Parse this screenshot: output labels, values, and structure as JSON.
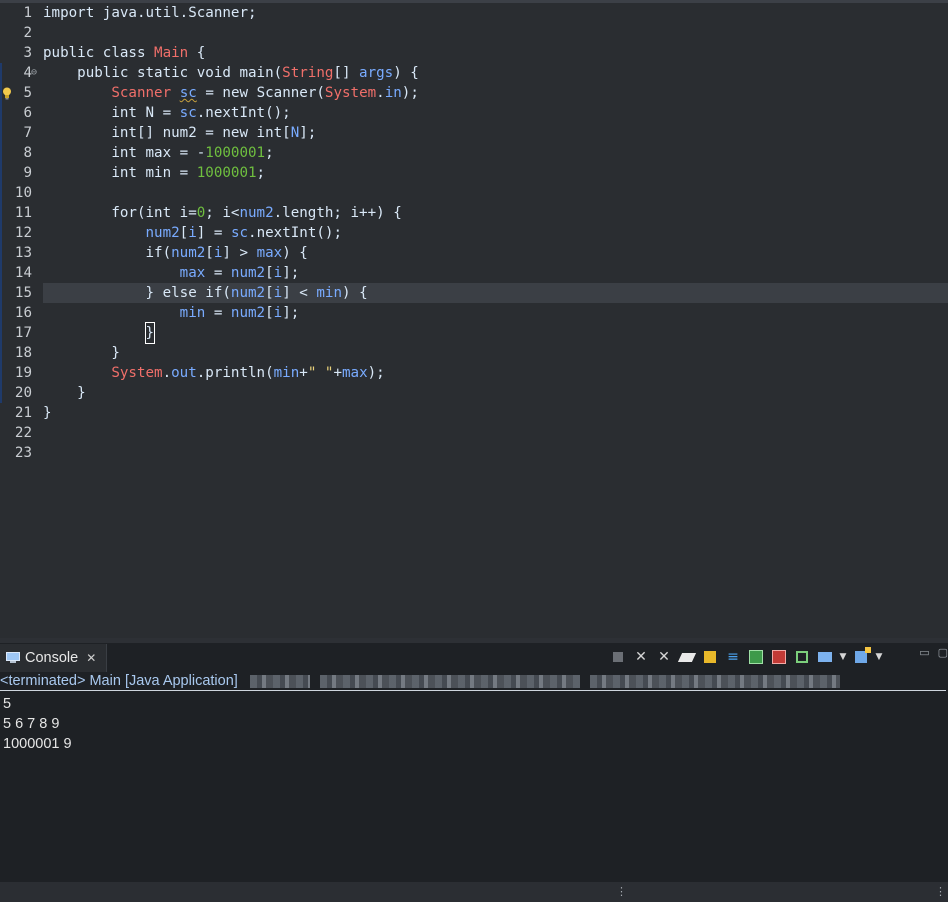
{
  "editor": {
    "lines": [
      {
        "n": "1",
        "tokens": [
          [
            "kw",
            "import java.util.Scanner;"
          ]
        ]
      },
      {
        "n": "2",
        "tokens": []
      },
      {
        "n": "3",
        "tokens": [
          [
            "kw",
            "public class "
          ],
          [
            "type",
            "Main"
          ],
          [
            "kw",
            " {"
          ]
        ]
      },
      {
        "n": "4",
        "tokens": [
          [
            "kw",
            "    public static void main("
          ],
          [
            "type",
            "String"
          ],
          [
            "kw",
            "[] "
          ],
          [
            "var",
            "args"
          ],
          [
            "kw",
            ") {"
          ]
        ]
      },
      {
        "n": "5",
        "tokens": [
          [
            "kw",
            "        "
          ],
          [
            "type",
            "Scanner"
          ],
          [
            "kw",
            " "
          ],
          [
            "var squig",
            "sc"
          ],
          [
            "kw",
            " = new Scanner("
          ],
          [
            "type",
            "System"
          ],
          [
            "kw",
            "."
          ],
          [
            "fld",
            "in"
          ],
          [
            "kw",
            ");"
          ]
        ]
      },
      {
        "n": "6",
        "tokens": [
          [
            "kw",
            "        int N = "
          ],
          [
            "var",
            "sc"
          ],
          [
            "kw",
            ".nextInt();"
          ]
        ]
      },
      {
        "n": "7",
        "tokens": [
          [
            "kw",
            "        int[] num2 = new int["
          ],
          [
            "var",
            "N"
          ],
          [
            "kw",
            "];"
          ]
        ]
      },
      {
        "n": "8",
        "tokens": [
          [
            "kw",
            "        int max = -"
          ],
          [
            "num",
            "1000001"
          ],
          [
            "kw",
            ";"
          ]
        ]
      },
      {
        "n": "9",
        "tokens": [
          [
            "kw",
            "        int min = "
          ],
          [
            "num",
            "1000001"
          ],
          [
            "kw",
            ";"
          ]
        ]
      },
      {
        "n": "10",
        "tokens": []
      },
      {
        "n": "11",
        "tokens": [
          [
            "kw",
            "        for(int i="
          ],
          [
            "num",
            "0"
          ],
          [
            "kw",
            "; i<"
          ],
          [
            "var",
            "num2"
          ],
          [
            "kw",
            ".length; i++) {"
          ]
        ]
      },
      {
        "n": "12",
        "tokens": [
          [
            "kw",
            "            "
          ],
          [
            "var",
            "num2"
          ],
          [
            "kw",
            "["
          ],
          [
            "var",
            "i"
          ],
          [
            "kw",
            "] = "
          ],
          [
            "var",
            "sc"
          ],
          [
            "kw",
            ".nextInt();"
          ]
        ]
      },
      {
        "n": "13",
        "tokens": [
          [
            "kw",
            "            if("
          ],
          [
            "var",
            "num2"
          ],
          [
            "kw",
            "["
          ],
          [
            "var",
            "i"
          ],
          [
            "kw",
            "] > "
          ],
          [
            "var",
            "max"
          ],
          [
            "kw",
            ") {"
          ]
        ]
      },
      {
        "n": "14",
        "tokens": [
          [
            "kw",
            "                "
          ],
          [
            "var",
            "max"
          ],
          [
            "kw",
            " = "
          ],
          [
            "var",
            "num2"
          ],
          [
            "kw",
            "["
          ],
          [
            "var",
            "i"
          ],
          [
            "kw",
            "];"
          ]
        ]
      },
      {
        "n": "15",
        "tokens": [
          [
            "kw",
            "            } else if("
          ],
          [
            "var",
            "num2"
          ],
          [
            "kw",
            "["
          ],
          [
            "var",
            "i"
          ],
          [
            "kw",
            "] < "
          ],
          [
            "var",
            "min"
          ],
          [
            "kw",
            ") {"
          ]
        ]
      },
      {
        "n": "16",
        "tokens": [
          [
            "kw",
            "                "
          ],
          [
            "var",
            "min"
          ],
          [
            "kw",
            " = "
          ],
          [
            "var",
            "num2"
          ],
          [
            "kw",
            "["
          ],
          [
            "var",
            "i"
          ],
          [
            "kw",
            "];"
          ]
        ]
      },
      {
        "n": "17",
        "tokens": [
          [
            "kw",
            "            "
          ],
          [
            "kw caret",
            "}"
          ]
        ]
      },
      {
        "n": "18",
        "tokens": [
          [
            "kw",
            "        }"
          ]
        ]
      },
      {
        "n": "19",
        "tokens": [
          [
            "kw",
            "        "
          ],
          [
            "type",
            "System"
          ],
          [
            "kw",
            "."
          ],
          [
            "fld",
            "out"
          ],
          [
            "kw",
            ".println("
          ],
          [
            "var",
            "min"
          ],
          [
            "kw",
            "+"
          ],
          [
            "str",
            "\" \""
          ],
          [
            "kw",
            "+"
          ],
          [
            "var",
            "max"
          ],
          [
            "kw",
            ");"
          ]
        ]
      },
      {
        "n": "20",
        "tokens": [
          [
            "kw",
            "    }"
          ]
        ]
      },
      {
        "n": "21",
        "tokens": [
          [
            "kw",
            "}"
          ]
        ]
      },
      {
        "n": "22",
        "tokens": []
      },
      {
        "n": "23",
        "tokens": []
      }
    ],
    "highlighted_line": "15",
    "fold_icon": "⊖",
    "quickfix_icon": "lightbulb-icon"
  },
  "console": {
    "tab_label": "Console",
    "tab_close": "✕",
    "status_terminated": "<terminated>",
    "status_text": " Main [Java Application] ",
    "output_lines": [
      "5",
      "5 6 7 8 9",
      "1000001 9"
    ],
    "toolbar_icons": [
      "terminate-icon",
      "remove-launch-icon",
      "remove-all-terminated-icon",
      "clear-console-icon",
      "scroll-lock-icon",
      "word-wrap-icon",
      "show-on-stdout-icon",
      "show-on-stderr-icon",
      "pin-console-icon",
      "display-selected-console-icon",
      "open-console-icon"
    ],
    "window_controls": [
      "▭",
      "▢"
    ]
  },
  "statusbar": {
    "grip": "⋮"
  }
}
